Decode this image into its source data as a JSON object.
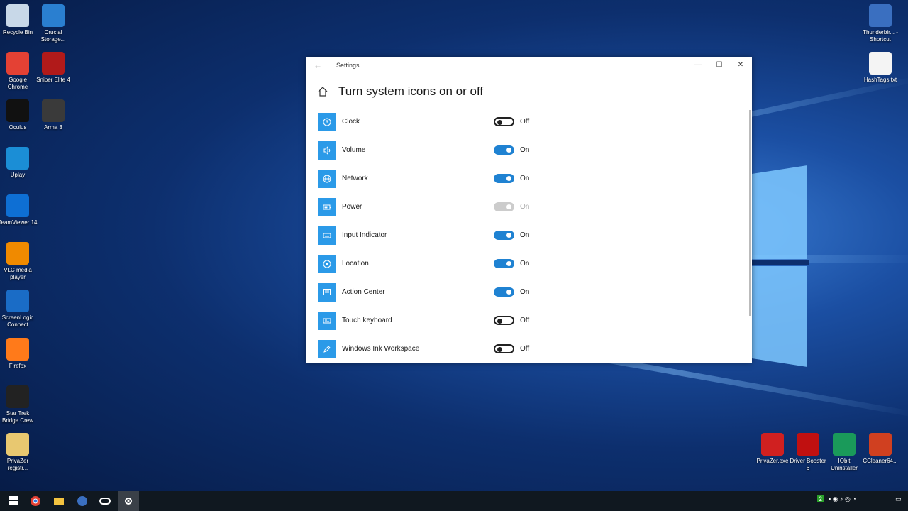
{
  "desktop": {
    "left_icons": [
      {
        "label": "Recycle Bin",
        "icon": "recycle-bin-icon",
        "color": "#c8d8e8"
      },
      {
        "label": "Crucial Storage...",
        "icon": "crucial-storage-icon",
        "color": "#2a7fd0"
      },
      {
        "label": "Google Chrome",
        "icon": "chrome-icon",
        "color": "#e44134"
      },
      {
        "label": "Sniper Elite 4",
        "icon": "sniper-elite-icon",
        "color": "#b11a1a"
      },
      {
        "label": "Oculus",
        "icon": "oculus-icon",
        "color": "#111111"
      },
      {
        "label": "Arma 3",
        "icon": "arma3-icon",
        "color": "#3a3a3a"
      },
      {
        "label": "Uplay",
        "icon": "uplay-icon",
        "color": "#1b8ed6"
      },
      {
        "label": "TeamViewer 14",
        "icon": "teamviewer-icon",
        "color": "#0e6fd4"
      },
      {
        "label": "VLC media player",
        "icon": "vlc-icon",
        "color": "#f08a00"
      },
      {
        "label": "ScreenLogic Connect",
        "icon": "screenlogic-icon",
        "color": "#1a6cc6"
      },
      {
        "label": "Firefox",
        "icon": "firefox-icon",
        "color": "#ff7a1a"
      },
      {
        "label": "Star Trek Bridge Crew",
        "icon": "star-trek-icon",
        "color": "#222222"
      },
      {
        "label": "PrivaZer registr...",
        "icon": "privazer-registry-icon",
        "color": "#e8c870"
      }
    ],
    "right_icons": [
      {
        "label": "Thunderbir... - Shortcut",
        "icon": "thunderbird-icon",
        "color": "#3a6fc0"
      },
      {
        "label": "HashTags.txt",
        "icon": "text-file-icon",
        "color": "#f4f4f4"
      },
      {
        "label": "PrivaZer.exe",
        "icon": "privazer-icon",
        "color": "#d02020"
      },
      {
        "label": "Driver Booster 6",
        "icon": "driver-booster-icon",
        "color": "#c01010"
      },
      {
        "label": "IObit Uninstaller",
        "icon": "iobit-uninstaller-icon",
        "color": "#1a9a5a"
      },
      {
        "label": "CCleaner64...",
        "icon": "ccleaner-icon",
        "color": "#d04020"
      }
    ]
  },
  "settings": {
    "window_title": "Settings",
    "page_title": "Turn system icons on or off",
    "items": [
      {
        "name": "Clock",
        "state": "Off",
        "toggle": "off",
        "icon": "clock-icon"
      },
      {
        "name": "Volume",
        "state": "On",
        "toggle": "on",
        "icon": "volume-icon"
      },
      {
        "name": "Network",
        "state": "On",
        "toggle": "on",
        "icon": "network-icon"
      },
      {
        "name": "Power",
        "state": "On",
        "toggle": "disabled",
        "icon": "power-icon"
      },
      {
        "name": "Input Indicator",
        "state": "On",
        "toggle": "on",
        "icon": "keyboard-icon"
      },
      {
        "name": "Location",
        "state": "On",
        "toggle": "on",
        "icon": "location-icon"
      },
      {
        "name": "Action Center",
        "state": "On",
        "toggle": "on",
        "icon": "action-center-icon"
      },
      {
        "name": "Touch keyboard",
        "state": "Off",
        "toggle": "off",
        "icon": "touch-keyboard-icon"
      },
      {
        "name": "Windows Ink Workspace",
        "state": "Off",
        "toggle": "off",
        "icon": "pen-icon"
      }
    ],
    "accent_color": "#2b9ae8",
    "toggle_on_color": "#1f82d2"
  },
  "taskbar": {
    "apps": [
      "start-icon",
      "chrome-icon",
      "file-explorer-icon",
      "thunderbird-icon",
      "oculus-icon",
      "settings-icon"
    ],
    "tray_badge": "2"
  }
}
